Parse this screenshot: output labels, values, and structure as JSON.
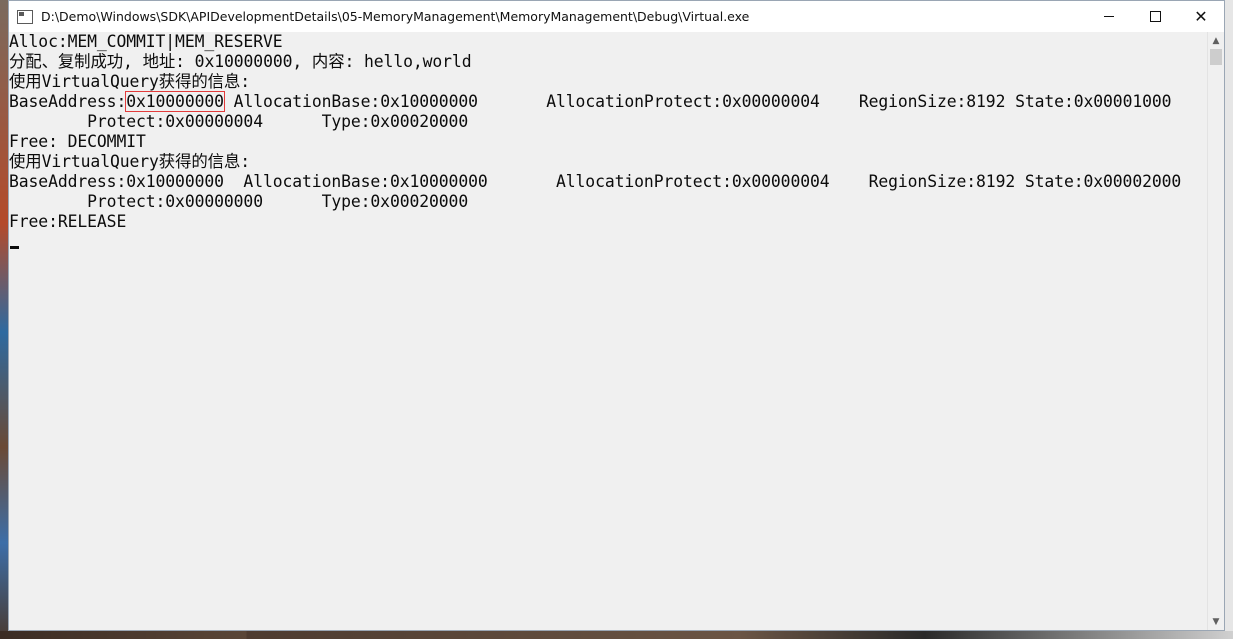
{
  "window": {
    "title": "D:\\Demo\\Windows\\SDK\\APIDevelopmentDetails\\05-MemoryManagement\\MemoryManagement\\Debug\\Virtual.exe",
    "minimize_glyph": "",
    "maximize_glyph": "",
    "close_glyph": "✕"
  },
  "console": {
    "lines": [
      "Alloc:MEM_COMMIT|MEM_RESERVE",
      "分配、复制成功, 地址: 0x10000000, 内容: hello,world",
      "使用VirtualQuery获得的信息:",
      "BaseAddress:",
      "0x10000000",
      " AllocationBase:0x10000000       AllocationProtect:0x00000004    RegionSize:8192 State:0x00001000",
      "        Protect:0x00000004      Type:0x00020000",
      "Free: DECOMMIT",
      "使用VirtualQuery获得的信息:",
      "BaseAddress:0x10000000  AllocationBase:0x10000000       AllocationProtect:0x00000004    RegionSize:8192 State:0x00002000",
      "        Protect:0x00000000      Type:0x00020000",
      "Free:RELEASE"
    ]
  },
  "scrollbar": {
    "up_glyph": "▲",
    "down_glyph": "▼"
  },
  "icons": {
    "app": "console-app-icon",
    "minimize": "minimize-icon",
    "maximize": "maximize-icon",
    "close": "close-icon"
  }
}
